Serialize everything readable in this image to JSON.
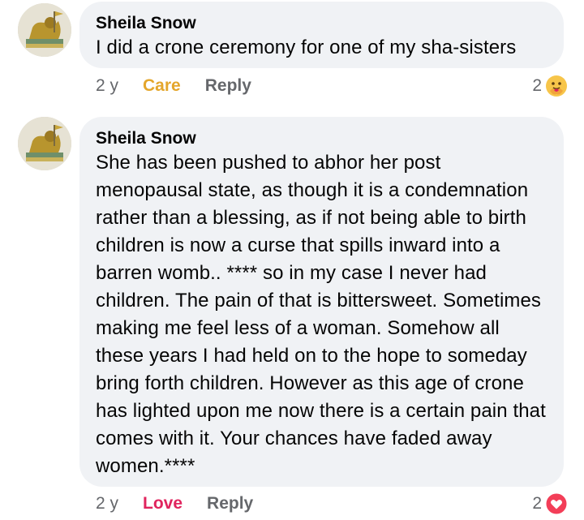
{
  "comments": [
    {
      "author": "Sheila Snow",
      "text": "I did a crone ceremony for one of my sha-sisters",
      "time": "2 y",
      "reaction_label": "Care",
      "reaction_color": "#e4a62c",
      "reply_label": "Reply",
      "reaction_count": "2",
      "reaction_icon": "care-emoji-icon"
    },
    {
      "author": "Sheila Snow",
      "text": "She has been pushed to abhor her post menopausal state, as though it is a condemnation rather than a blessing, as if not being able to birth children is now a curse that spills inward into a barren womb.. **** so in my case I never had children. The pain of that is bittersweet. Sometimes making me feel less of a woman. Somehow all these years I had held on to the hope to someday bring forth children. However as this age of crone has lighted upon me now there is a certain pain that comes with it. Your chances have faded away women.****",
      "time": "2 y",
      "reaction_label": "Love",
      "reaction_color": "#e0245e",
      "reply_label": "Reply",
      "reaction_count": "2",
      "reaction_icon": "heart-icon"
    }
  ]
}
